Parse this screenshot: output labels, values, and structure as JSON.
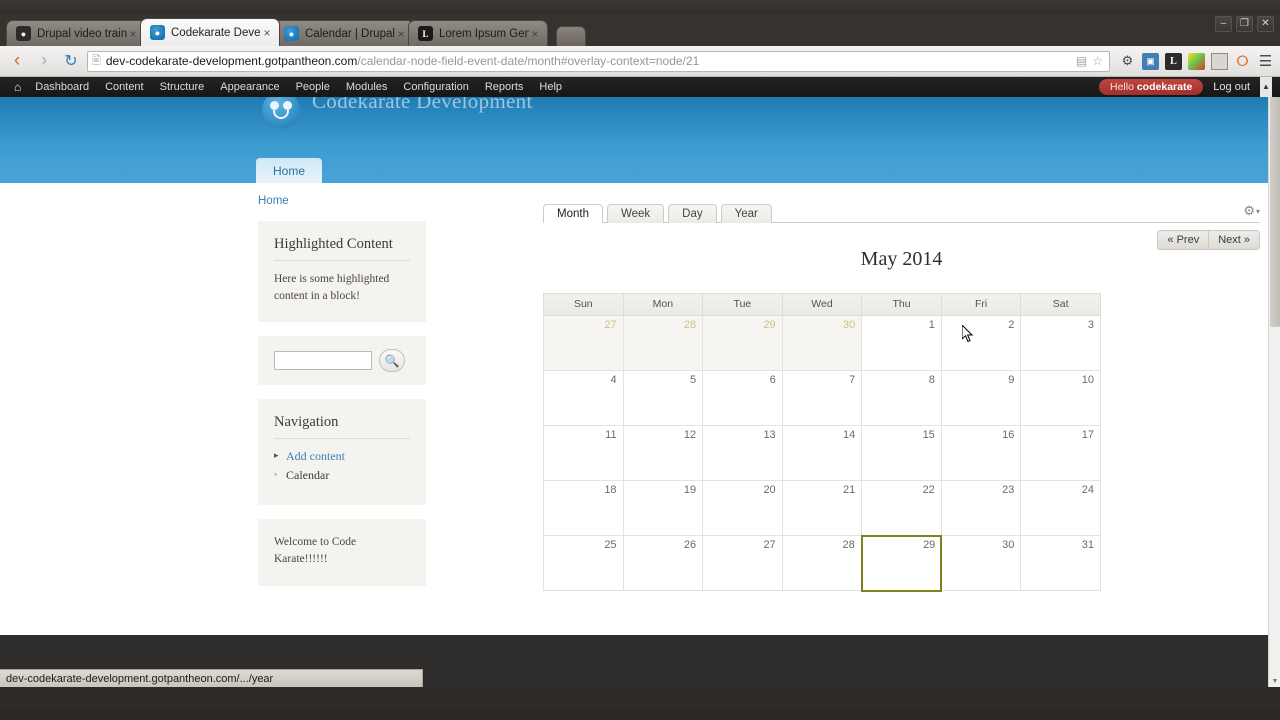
{
  "window": {
    "controls": {
      "minimize": "–",
      "maximize": "❐",
      "close": "✕"
    }
  },
  "browser": {
    "tabs": [
      {
        "title": "Drupal video training",
        "favicon": "ninja-icon",
        "active": false,
        "close": "×"
      },
      {
        "title": "Codekarate Developm",
        "favicon": "drupal-icon",
        "active": true,
        "close": "×"
      },
      {
        "title": "Calendar | Drupal.org",
        "favicon": "drupal-icon",
        "active": false,
        "close": "×"
      },
      {
        "title": "Lorem Ipsum Generat",
        "favicon": "lorem-icon",
        "active": false,
        "close": "×"
      }
    ],
    "new_tab_label": "",
    "nav": {
      "back": "‹",
      "forward": "›",
      "reload": "↻",
      "page_icon": "☷",
      "url_host": "dev-codekarate-development.gotpantheon.com",
      "url_path": "/calendar-node-field-event-date/month#overlay-context=node/21",
      "reader_icon": "▤",
      "bookmark_icon": "☆",
      "extensions": [
        "gear-icon",
        "screenshot-icon",
        "L",
        "colorpicker-icon",
        "window-icon",
        "opera-icon",
        "menu-icon"
      ]
    }
  },
  "admin_toolbar": {
    "home_icon": "⌂",
    "links": [
      "Dashboard",
      "Content",
      "Structure",
      "Appearance",
      "People",
      "Modules",
      "Configuration",
      "Reports",
      "Help"
    ],
    "hello_prefix": "Hello ",
    "hello_user": "codekarate",
    "logout": "Log out",
    "collapse": "▲"
  },
  "site": {
    "name": "Codekarate Development",
    "primary_tabs": [
      {
        "label": "Home",
        "active": true
      }
    ],
    "header_color": "#3d9bd1"
  },
  "breadcrumb": {
    "items": [
      "Home"
    ]
  },
  "sidebar": {
    "blocks": [
      {
        "id": "highlighted-content",
        "title": "Highlighted Content",
        "body": "Here is some highlighted content in a block!"
      },
      {
        "id": "search",
        "input_value": "",
        "input_placeholder": "",
        "button_icon": "search-icon"
      },
      {
        "id": "navigation",
        "title": "Navigation",
        "items": [
          {
            "label": "Add content",
            "marker": "▸",
            "link": true
          },
          {
            "label": "Calendar",
            "marker": "◦",
            "link": false
          }
        ]
      },
      {
        "id": "welcome",
        "body": "Welcome to Code Karate!!!!!!"
      }
    ]
  },
  "calendar": {
    "view_tabs": [
      {
        "label": "Month",
        "active": true
      },
      {
        "label": "Week",
        "active": false
      },
      {
        "label": "Day",
        "active": false
      },
      {
        "label": "Year",
        "active": false
      }
    ],
    "gear_icon": "⚙",
    "gear_caret": "▾",
    "title": "May 2014",
    "prev_label": "« Prev",
    "next_label": "Next »",
    "weekdays": [
      "Sun",
      "Mon",
      "Tue",
      "Wed",
      "Thu",
      "Fri",
      "Sat"
    ],
    "today_border_color": "#808020",
    "weeks": [
      [
        {
          "day": "27",
          "other_month": true
        },
        {
          "day": "28",
          "other_month": true
        },
        {
          "day": "29",
          "other_month": true
        },
        {
          "day": "30",
          "other_month": true
        },
        {
          "day": "1",
          "other_month": false
        },
        {
          "day": "2",
          "other_month": false
        },
        {
          "day": "3",
          "other_month": false
        }
      ],
      [
        {
          "day": "4",
          "other_month": false
        },
        {
          "day": "5",
          "other_month": false
        },
        {
          "day": "6",
          "other_month": false
        },
        {
          "day": "7",
          "other_month": false
        },
        {
          "day": "8",
          "other_month": false
        },
        {
          "day": "9",
          "other_month": false
        },
        {
          "day": "10",
          "other_month": false
        }
      ],
      [
        {
          "day": "11",
          "other_month": false
        },
        {
          "day": "12",
          "other_month": false
        },
        {
          "day": "13",
          "other_month": false
        },
        {
          "day": "14",
          "other_month": false
        },
        {
          "day": "15",
          "other_month": false
        },
        {
          "day": "16",
          "other_month": false
        },
        {
          "day": "17",
          "other_month": false
        }
      ],
      [
        {
          "day": "18",
          "other_month": false
        },
        {
          "day": "19",
          "other_month": false
        },
        {
          "day": "20",
          "other_month": false
        },
        {
          "day": "21",
          "other_month": false
        },
        {
          "day": "22",
          "other_month": false
        },
        {
          "day": "23",
          "other_month": false
        },
        {
          "day": "24",
          "other_month": false
        }
      ],
      [
        {
          "day": "25",
          "other_month": false
        },
        {
          "day": "26",
          "other_month": false
        },
        {
          "day": "27",
          "other_month": false
        },
        {
          "day": "28",
          "other_month": false
        },
        {
          "day": "29",
          "other_month": false,
          "today": true
        },
        {
          "day": "30",
          "other_month": false
        },
        {
          "day": "31",
          "other_month": false
        }
      ]
    ]
  },
  "statusbar": {
    "text": "dev-codekarate-development.gotpantheon.com/.../year"
  }
}
